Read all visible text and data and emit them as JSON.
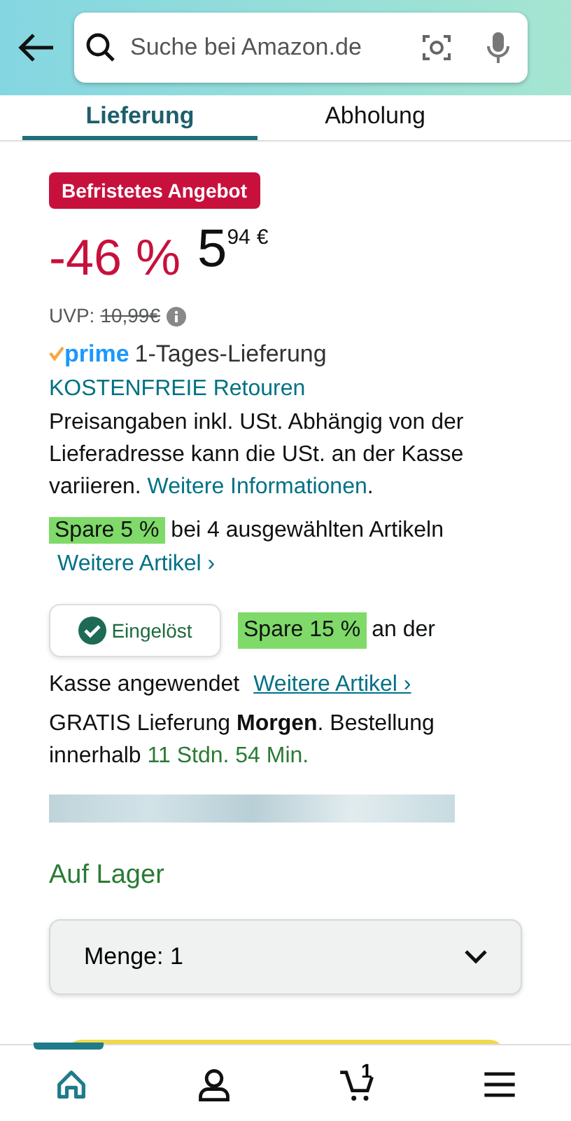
{
  "header": {
    "search_placeholder": "Suche bei Amazon.de"
  },
  "tabs": [
    {
      "label": "Lieferung",
      "selected": true
    },
    {
      "label": "Abholung",
      "selected": false
    }
  ],
  "deal_badge": "Befristetes Angebot",
  "price": {
    "discount": "-46 %",
    "whole": "5",
    "fraction": "94",
    "currency": "€"
  },
  "list_price": {
    "label": "UVP:",
    "value": "10,99€"
  },
  "prime": {
    "logo": "prime",
    "delivery": "1-Tages-Lieferung"
  },
  "returns_link": "KOSTENFREIE Retouren",
  "tax_note": {
    "text": "Preisangaben inkl. USt. Abhängig von der Lieferadresse kann die USt. an der Kasse variieren.",
    "link": "Weitere Informationen",
    "end": "."
  },
  "promo": {
    "highlight": "Spare 5 %",
    "text": "bei 4 ausgewählten Artikeln",
    "link": "Weitere Artikel",
    "chevron": "›"
  },
  "coupon": {
    "chip": "Eingelöst",
    "redeemed": true,
    "highlight": "Spare 15 %",
    "text_line1": "an der",
    "text_line2": "Kasse angewendet",
    "link": "Weitere Artikel",
    "chevron": "›"
  },
  "delivery": {
    "text": "GRATIS Lieferung **Morgen**. Bestellung innerhalb",
    "countdown": "11 Stdn. 54 Min."
  },
  "stock": "Auf Lager",
  "quantity": {
    "label": "Menge:",
    "value": "1"
  },
  "nav": [
    {
      "kind": "home",
      "selected": true
    },
    {
      "kind": "account",
      "selected": false
    },
    {
      "kind": "cart",
      "selected": false,
      "count": "1"
    },
    {
      "kind": "menu",
      "selected": false
    }
  ]
}
